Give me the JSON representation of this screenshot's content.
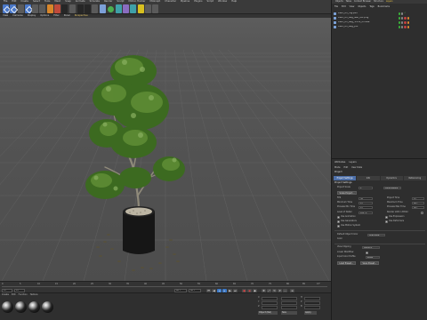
{
  "menubar": {
    "items": [
      "File",
      "Edit",
      "Create",
      "Select",
      "Tools",
      "Mesh",
      "Snap",
      "Animate",
      "Simulate",
      "Render",
      "Sculpt",
      "Motion Tracker",
      "MoGraph",
      "Character",
      "Pipeline",
      "Plugins",
      "Script",
      "Window",
      "Help"
    ]
  },
  "viewport": {
    "menu": [
      "View",
      "Cameras",
      "Display",
      "Options",
      "Filter",
      "Panel"
    ],
    "camera_label": "Perspective"
  },
  "timeline": {
    "ticks": [
      "0",
      "5",
      "10",
      "15",
      "20",
      "25",
      "30",
      "35",
      "40",
      "45",
      "50",
      "55",
      "60",
      "65",
      "70",
      "75",
      "80",
      "85",
      "90"
    ],
    "frame_end_label": "0 F",
    "start_frame": "0 F",
    "current_frame": "0 F",
    "end_frame": "90 F",
    "end_frame_b": "90 F"
  },
  "materials": {
    "menu": [
      "Create",
      "Edit",
      "Function",
      "Texture"
    ],
    "count": 4
  },
  "coordinates": {
    "labels": [
      "X",
      "Y",
      "Z"
    ],
    "size_labels": [
      "H",
      "P",
      "B"
    ],
    "apply_label": "Apply",
    "mode_a": "Object (Rel)",
    "mode_b": "Size"
  },
  "objects_panel": {
    "tabs": [
      "Objects",
      "Takes",
      "Content Browser",
      "Structure"
    ],
    "active_tab": "Layers",
    "menu": [
      "File",
      "Edit",
      "View",
      "Objects",
      "Tags",
      "Bookmarks"
    ],
    "items": [
      {
        "name": "plant_01_mg.psd",
        "flags": [
          "green",
          "grey",
          "check"
        ]
      },
      {
        "name": "plant_01_bag_leaf_diff.png",
        "flags": [
          "green",
          "grey",
          "red",
          "orange"
        ]
      },
      {
        "name": "plant_01_bag_Trunk_diffuse",
        "flags": [
          "green",
          "grey",
          "red",
          "orange"
        ]
      },
      {
        "name": "plant_01_bag_pot",
        "flags": [
          "green",
          "grey",
          "red",
          "orange"
        ]
      }
    ]
  },
  "attributes_panel": {
    "top_tabs": [
      "Attributes",
      "Layers"
    ],
    "menu": [
      "Mode",
      "Edit",
      "User Data"
    ],
    "object_label": "Project",
    "subtabs": [
      "Project Settings",
      "Info",
      "Dynamics",
      "Referencing"
    ],
    "section_title": "Project Settings",
    "fields": {
      "project_scale_label": "Project Scale",
      "project_scale_value": "1",
      "project_scale_unit": "Centimeters",
      "scale_project_btn": "Scale Project...",
      "fps_label": "FPS",
      "fps_value": "30",
      "project_time_label": "Project Time",
      "project_time_value": "0 F",
      "min_time_label": "Minimum Time",
      "min_time_value": "0 F",
      "max_time_label": "Maximum Time",
      "max_time_value": "90 F",
      "preview_min_label": "Preview Min Time",
      "preview_min_value": "0 F",
      "preview_max_label": "Preview Max Time",
      "preview_max_value": "90 F",
      "lod_label": "Level of Detail",
      "lod_value": "100 %",
      "render_lod_label": "Render LOD in Editor",
      "use_animation_label": "Use Animation",
      "use_expression_label": "Use Expression",
      "use_generators_label": "Use Generators",
      "use_deformers_label": "Use Deformers",
      "use_motion_label": "Use Motion System",
      "default_object_color_label": "Default Object Color",
      "default_object_color_value": "Gray-Blue",
      "color_label": "Color",
      "view_clipping_label": "View Clipping",
      "view_clipping_value": "Medium",
      "linear_workflow_label": "Linear Workflow",
      "input_color_label": "Input Color Profile",
      "input_color_value": "sRGB",
      "load_preset_btn": "Load Preset...",
      "save_preset_btn": "Save Preset..."
    }
  },
  "colors": {
    "accent_blue": "#4a78c8",
    "active_tab": "#e6c040",
    "object_flag_on": "#3ab03a",
    "pot": "#151515",
    "foliage": "#4a7a2a"
  }
}
